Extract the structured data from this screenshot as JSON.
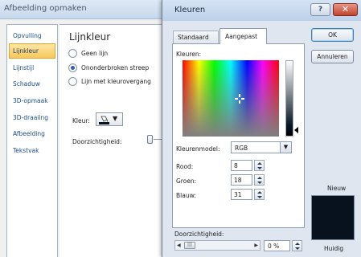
{
  "back_dialog": {
    "title": "Afbeelding opmaken",
    "nav": [
      "Opvulling",
      "Lijnkleur",
      "Lijnstijl",
      "Schaduw",
      "3D-opmaak",
      "3D-draaiing",
      "Afbeelding",
      "Tekstvak"
    ],
    "selected_nav": "Lijnkleur",
    "heading": "Lijnkleur",
    "radios": [
      "Geen lijn",
      "Ononderbroken streep",
      "Lijn met kleurovergang"
    ],
    "selected_radio": "Ononderbroken streep",
    "color_label": "Kleur:",
    "transparency_label": "Doorzichtigheid:"
  },
  "front_dialog": {
    "title": "Kleuren",
    "help_glyph": "?",
    "close_glyph": "✕",
    "tabs": [
      "Standaard",
      "Aangepast"
    ],
    "active_tab": "Aangepast",
    "colors_label": "Kleuren:",
    "model_label": "Kleurenmodel:",
    "model_value": "RGB",
    "red_label": "Rood:",
    "red_value": "8",
    "green_label": "Groen:",
    "green_value": "18",
    "blue_label": "Blauw:",
    "blue_value": "31",
    "transparency_label": "Doorzichtigheid:",
    "transparency_value": "0 %",
    "ok_label": "OK",
    "cancel_label": "Annuleren",
    "new_label": "Nieuw",
    "current_label": "Huidig",
    "preview_color": "#08121f"
  }
}
